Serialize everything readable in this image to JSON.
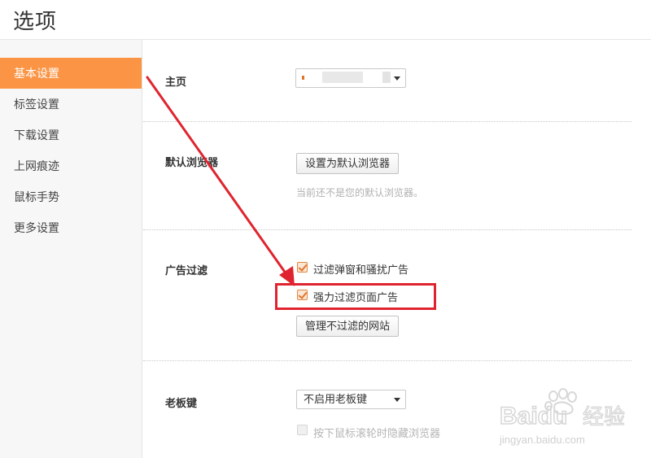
{
  "window": {
    "title": "选项"
  },
  "sidebar": {
    "items": [
      {
        "label": "基本设置",
        "active": true
      },
      {
        "label": "标签设置"
      },
      {
        "label": "下载设置"
      },
      {
        "label": "上网痕迹"
      },
      {
        "label": "鼠标手势"
      },
      {
        "label": "更多设置"
      }
    ]
  },
  "sections": {
    "homepage": {
      "label": "主页"
    },
    "default_browser": {
      "label": "默认浏览器",
      "button": "设置为默认浏览器",
      "hint": "当前还不是您的默认浏览器。"
    },
    "ad_filter": {
      "label": "广告过滤",
      "option1": {
        "label": "过滤弹窗和骚扰广告",
        "checked": true
      },
      "option2": {
        "label": "强力过滤页面广告",
        "checked": true
      },
      "manage_button": "管理不过滤的网站"
    },
    "boss_key": {
      "label": "老板键",
      "select_value": "不启用老板键",
      "option": {
        "label": "按下鼠标滚轮时隐藏浏览器",
        "checked": false,
        "disabled": true
      }
    }
  },
  "annotation": {
    "highlight_color": "#e0242f",
    "arrow_color": "#e0242f"
  },
  "watermark": {
    "brand": "Baidu",
    "brand2": "经验",
    "url": "jingyan.baidu.com"
  },
  "colors": {
    "accent": "#fb9545",
    "sidebar_bg": "#f7f7f7"
  }
}
